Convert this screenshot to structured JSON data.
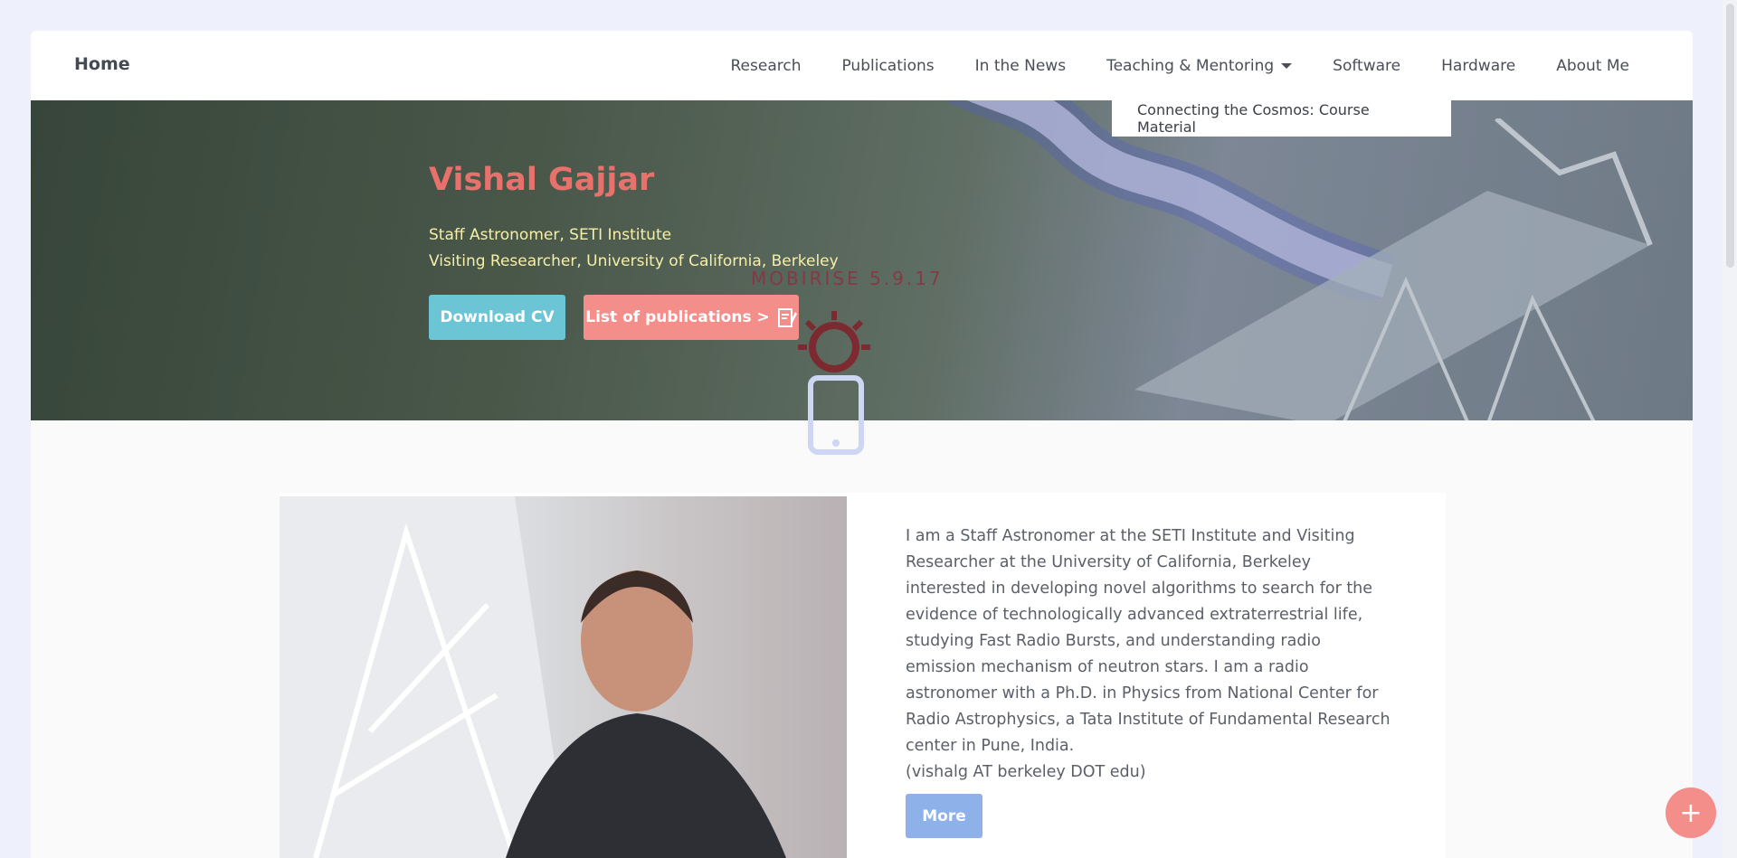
{
  "navbar": {
    "brand": "Home",
    "links": [
      "Research",
      "Publications",
      "In the News",
      "Teaching & Mentoring",
      "Software",
      "Hardware",
      "About Me"
    ],
    "dropdown_item": "Connecting the Cosmos: Course Material"
  },
  "hero": {
    "name": "Vishal Gajjar",
    "line1": "Staff Astronomer, SETI Institute",
    "line2": "Visiting Researcher, University of California, Berkeley",
    "cv_button": "Download CV",
    "pubs_button": "List of publications >",
    "watermark": "MOBIRISE 5.9.17"
  },
  "about": {
    "bio": "I am a Staff Astronomer at the SETI Institute and Visiting Researcher at the University of California, Berkeley interested in developing novel algorithms to search for the evidence of technologically advanced extraterrestrial life, studying Fast Radio Bursts, and understanding radio emission mechanism of neutron stars. I am a radio astronomer with a Ph.D. in Physics from National Center for Radio Astrophysics, a Tata Institute of Fundamental Research center in Pune, India.",
    "email": "(vishalg AT berkeley DOT edu)",
    "more_button": "More"
  },
  "fab": {
    "label": "+"
  },
  "colors": {
    "accent_red": "#e8716c",
    "button_teal": "#6cc5d4",
    "button_salmon": "#f48e8b",
    "button_blue": "#8fb1ea",
    "subtitle_yellow": "#f7efa8"
  }
}
